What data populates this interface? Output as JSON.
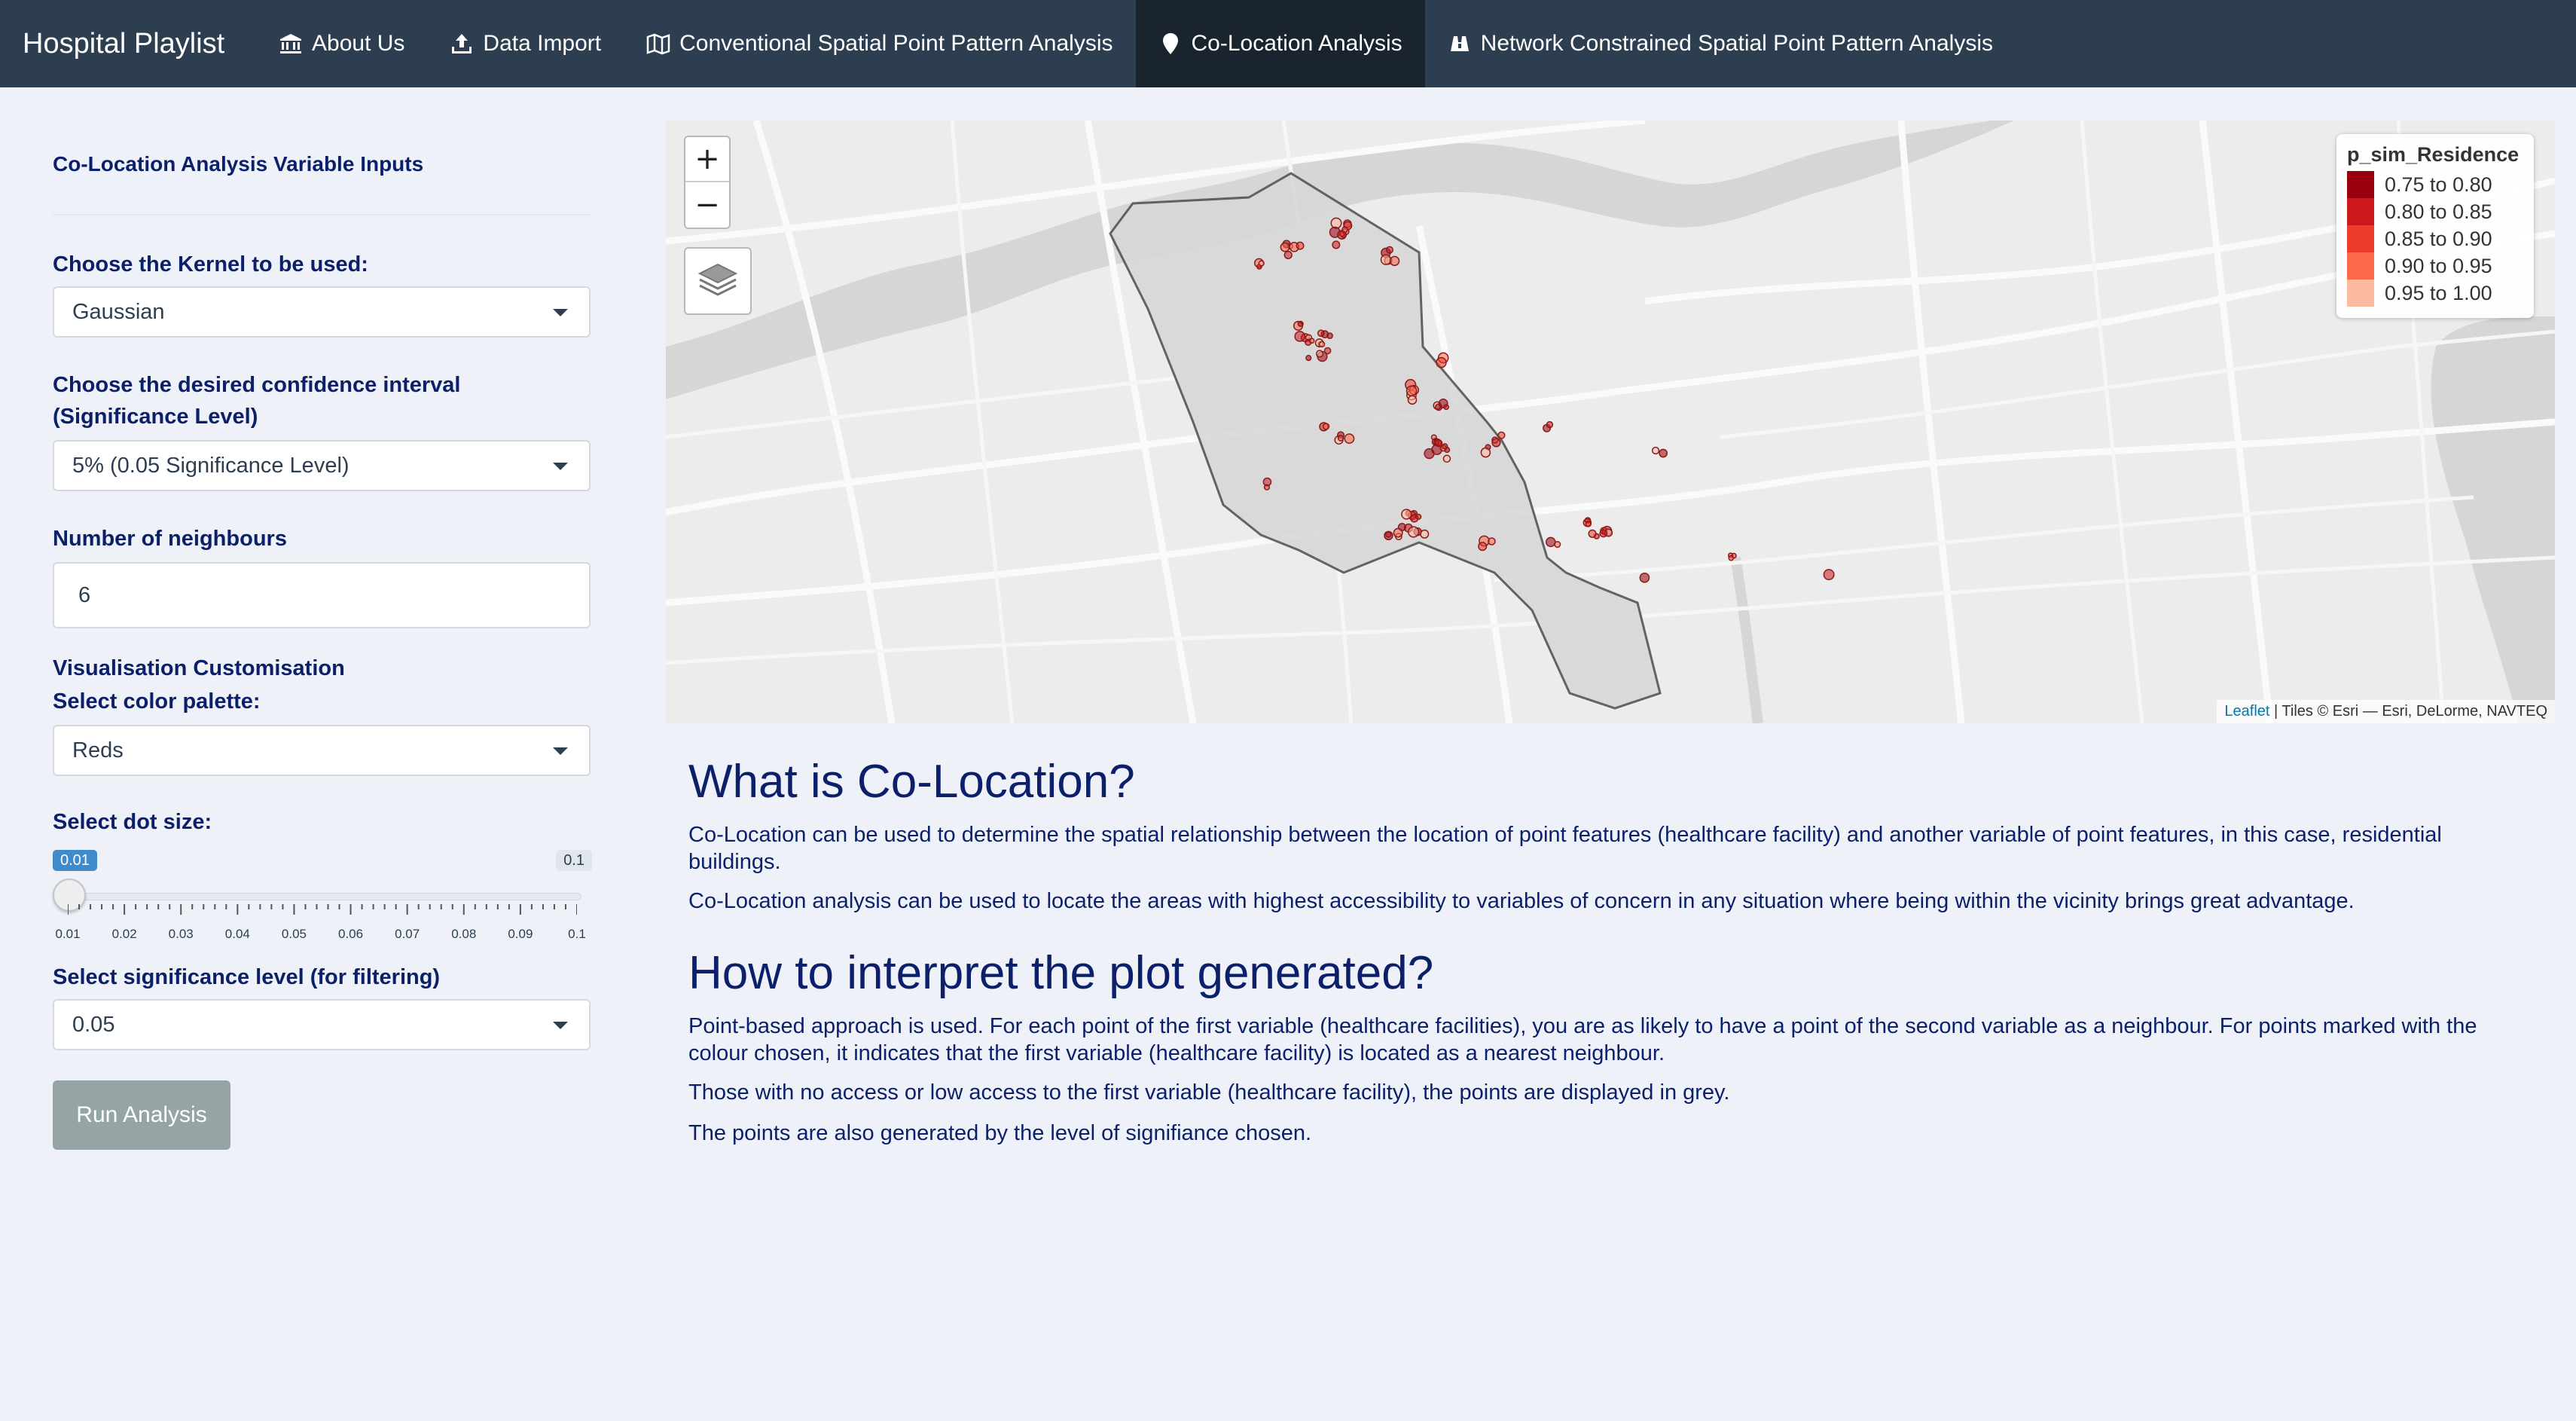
{
  "navbar": {
    "brand": "Hospital Playlist",
    "items": [
      {
        "label": "About Us",
        "icon": "bank-icon",
        "active": false
      },
      {
        "label": "Data Import",
        "icon": "upload-icon",
        "active": false
      },
      {
        "label": "Conventional Spatial Point Pattern Analysis",
        "icon": "map-icon",
        "active": false
      },
      {
        "label": "Co-Location Analysis",
        "icon": "map-marker-icon",
        "active": true
      },
      {
        "label": "Network Constrained Spatial Point Pattern Analysis",
        "icon": "binoculars-icon",
        "active": false
      }
    ]
  },
  "sidebar": {
    "title": "Co-Location Analysis Variable Inputs",
    "kernel": {
      "label": "Choose the Kernel to be used:",
      "value": "Gaussian"
    },
    "confidence": {
      "label": "Choose the desired confidence interval (Significance Level)",
      "value": "5% (0.05 Significance Level)"
    },
    "neighbours": {
      "label": "Number of neighbours",
      "value": "6"
    },
    "visualisation_label": "Visualisation Customisation",
    "palette": {
      "label": "Select color palette:",
      "value": "Reds"
    },
    "dot_size": {
      "label": "Select dot size:",
      "min_label": "0.01",
      "max_label": "0.1",
      "value": 0.01,
      "ticks": [
        "0.01",
        "0.02",
        "0.03",
        "0.04",
        "0.05",
        "0.06",
        "0.07",
        "0.08",
        "0.09",
        "0.1"
      ]
    },
    "significance": {
      "label": "Select significance level (for filtering)",
      "value": "0.05"
    },
    "run_button": "Run Analysis"
  },
  "map": {
    "zoom_in": "+",
    "zoom_out": "−",
    "legend": {
      "title": "p_sim_Residence",
      "entries": [
        {
          "label": "0.75 to 0.80",
          "color": "#99000d"
        },
        {
          "label": "0.80 to 0.85",
          "color": "#cb181d"
        },
        {
          "label": "0.85 to 0.90",
          "color": "#ef3b2c"
        },
        {
          "label": "0.90 to 0.95",
          "color": "#fb6a4a"
        },
        {
          "label": "0.95 to 1.00",
          "color": "#fcbba1"
        }
      ]
    },
    "attribution_link": "Leaflet",
    "attribution_text": " | Tiles © Esri — Esri, DeLorme, NAVTEQ"
  },
  "content": {
    "heading1": "What is Co-Location?",
    "para1": "Co-Location can be used to determine the spatial relationship between the location of point features (healthcare facility) and another variable of point features, in this case, residential buildings.",
    "para2": "Co-Location analysis can be used to locate the areas with highest accessibility to variables of concern in any situation where being within the vicinity brings great advantage.",
    "heading2": "How to interpret the plot generated?",
    "para3": "Point-based approach is used. For each point of the first variable (healthcare facilities), you are as likely to have a point of the second variable as a neighbour. For points marked with the colour chosen, it indicates that the first variable (healthcare facility) is located as a nearest neighbour.",
    "para4": "Those with no access or low access to the first variable (healthcare facility), the points are displayed in grey.",
    "para5": "The points are also generated by the level of signifiance chosen."
  },
  "colors": {
    "navbar": "#2c3e50",
    "navbar_active": "#1a242f",
    "text": "#0b1f6b",
    "button": "#95a5a6",
    "slider_accent": "#428bca"
  }
}
